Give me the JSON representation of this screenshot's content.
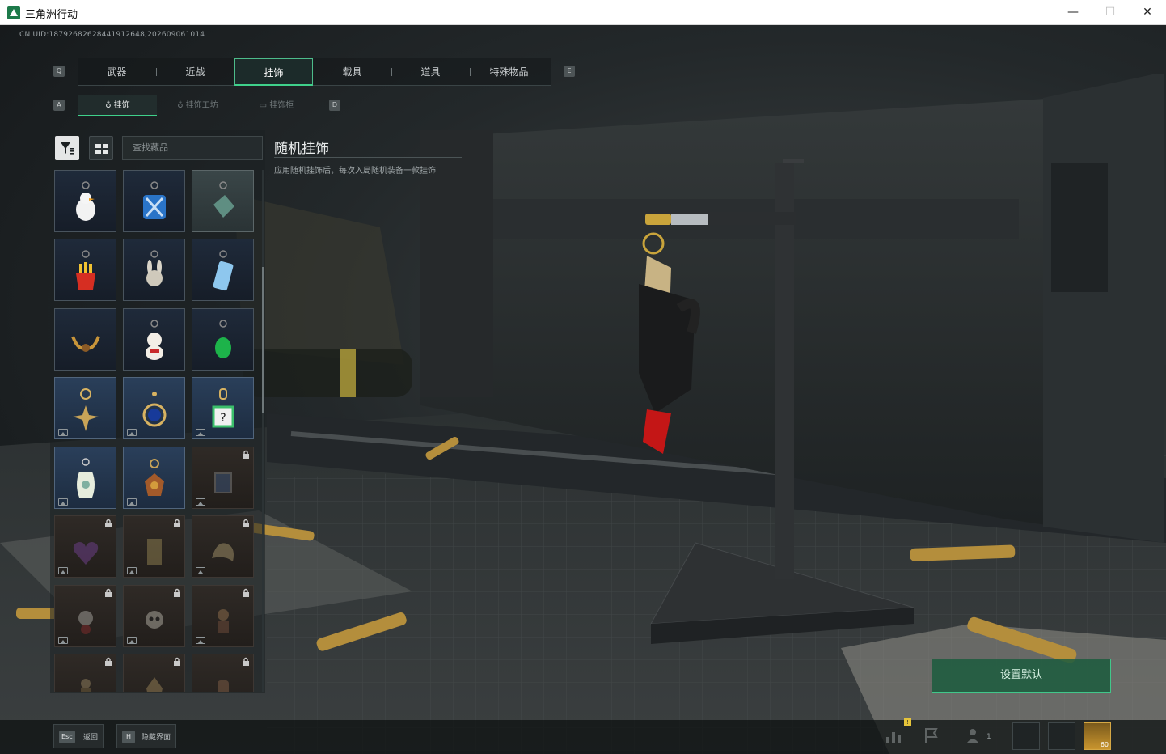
{
  "window": {
    "title": "三角洲行动",
    "minimize": "—",
    "maximize": "☐",
    "close": "✕"
  },
  "uid": "CN UID:1879268262844191264​8,202609061014",
  "tabs": {
    "prev_key": "Q",
    "next_key": "E",
    "items": [
      {
        "label": "武器"
      },
      {
        "label": "近战"
      },
      {
        "label": "挂饰",
        "active": true
      },
      {
        "label": "载具"
      },
      {
        "label": "道具"
      },
      {
        "label": "特殊物品"
      }
    ]
  },
  "subtabs": {
    "prev_key": "A",
    "next_key": "D",
    "items": [
      {
        "label": "挂饰",
        "active": true
      },
      {
        "label": "挂饰工坊"
      },
      {
        "label": "挂饰柜"
      }
    ]
  },
  "search": {
    "placeholder": "查找藏品"
  },
  "grid": {
    "rows": [
      [
        "duck",
        "blue-cross",
        "green-card"
      ],
      [
        "fries",
        "rabbit",
        "phone"
      ],
      [
        "antlers",
        "lucky-cat",
        "green-egg"
      ],
      [
        "star-pendant",
        "blue-orb",
        "square-tag"
      ],
      [
        "ornate-vase",
        "bronze-medal",
        "locked-frame"
      ],
      [
        "purple-heart",
        "gold-card",
        "dragon"
      ],
      [
        "rose-figure",
        "skull",
        "doll"
      ],
      [
        "soldier",
        "warrior",
        "lantern"
      ]
    ]
  },
  "detail": {
    "title": "随机挂饰",
    "description": "应用随机挂饰后，每次入局随机装备一款挂饰"
  },
  "actions": {
    "set_default": "设置默认"
  },
  "bottom": {
    "back_key": "Esc",
    "back_label": "返回",
    "hide_key": "H",
    "hide_label": "隐藏界面",
    "notification_badge": "!",
    "friends_count": "1",
    "avatar_level": "60"
  },
  "colors": {
    "accent": "#3fd18b",
    "tile_locked": "#2f2a26",
    "tile_default": "#1f2a3a"
  }
}
